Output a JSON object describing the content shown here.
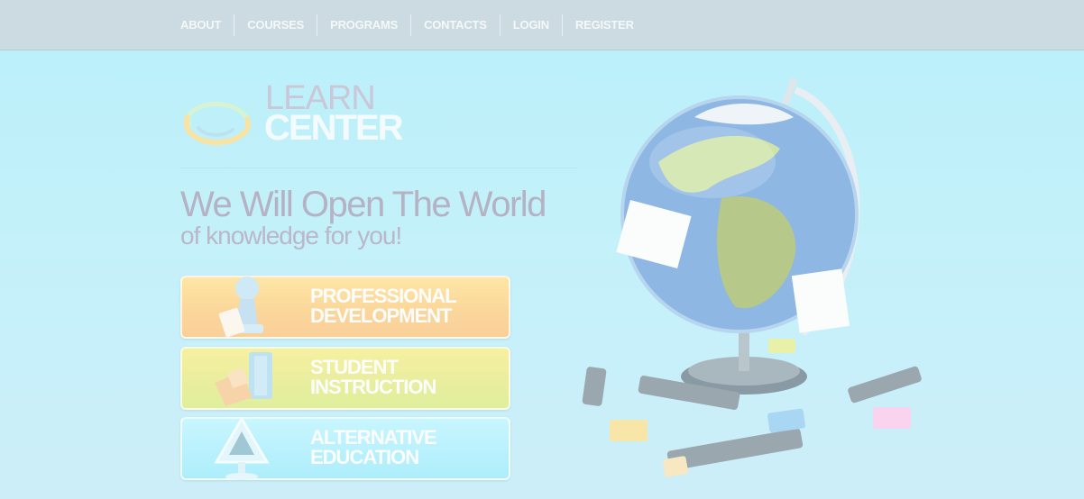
{
  "nav": {
    "items": [
      {
        "label": "ABOUT"
      },
      {
        "label": "COURSES"
      },
      {
        "label": "PROGRAMS"
      },
      {
        "label": "CONTACTS"
      },
      {
        "label": "LOGIN"
      },
      {
        "label": "REGISTER"
      }
    ]
  },
  "logo": {
    "line1": "LEARN",
    "line2": "CENTER"
  },
  "hero": {
    "headline": "We Will Open The World",
    "subline": "of knowledge for you!"
  },
  "buttons": [
    {
      "line1": "PROFESSIONAL",
      "line2": "DEVELOPMENT",
      "icon": "chess-pawn-icon"
    },
    {
      "line1": "STUDENT",
      "line2": "INSTRUCTION",
      "icon": "books-icon"
    },
    {
      "line1": "ALTERNATIVE",
      "line2": "EDUCATION",
      "icon": "warning-sign-icon"
    }
  ],
  "illustration": {
    "icon": "globe-icon"
  }
}
